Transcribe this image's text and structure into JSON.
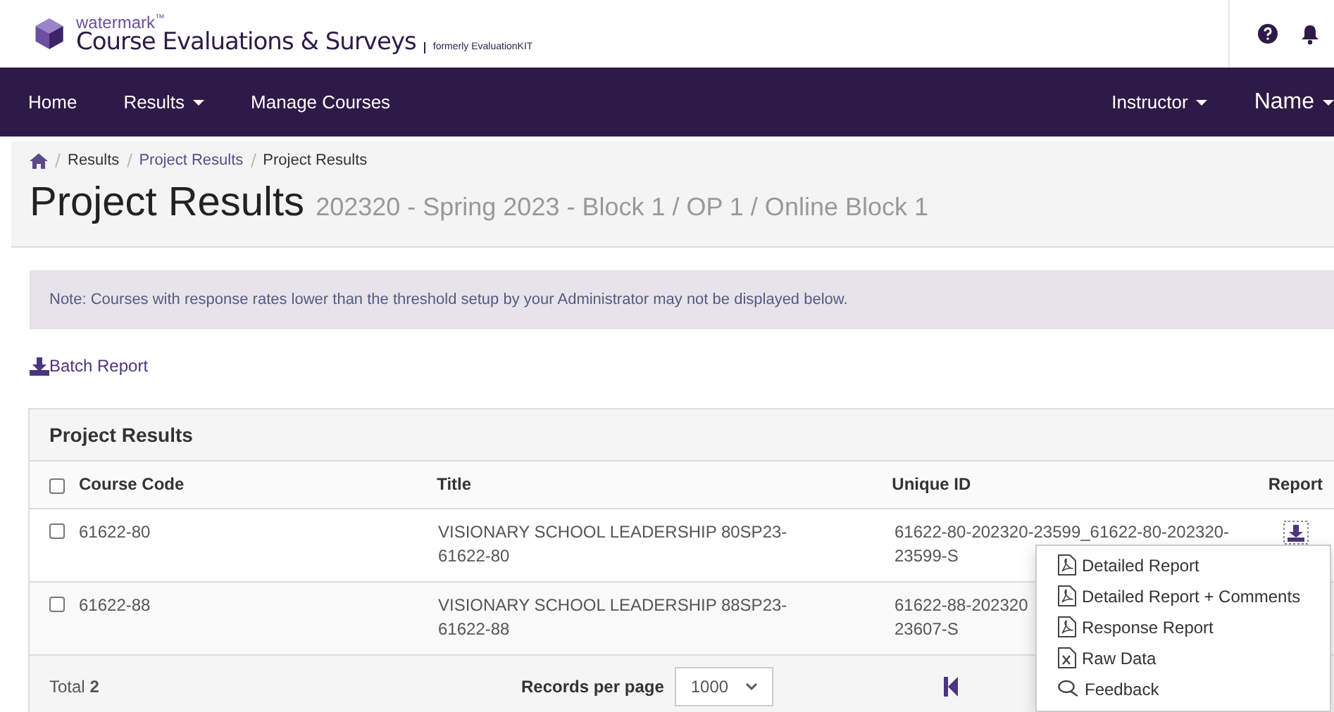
{
  "brand": {
    "name": "watermark",
    "trademark": "™",
    "product": "Course Evaluations & Surveys",
    "former": "formerly EvaluationKIT"
  },
  "nav": {
    "left": [
      {
        "label": "Home",
        "has_menu": false
      },
      {
        "label": "Results",
        "has_menu": true
      },
      {
        "label": "Manage Courses",
        "has_menu": false
      }
    ],
    "right": [
      {
        "label": "Instructor",
        "has_menu": true,
        "large": false
      },
      {
        "label": "Name",
        "has_menu": true,
        "large": true
      }
    ]
  },
  "breadcrumb": [
    "Results",
    "Project Results",
    "Project Results"
  ],
  "page": {
    "title": "Project Results",
    "subtitle": "202320 - Spring 2023 - Block 1 / OP 1 / Online Block 1"
  },
  "note": "Note: Courses with response rates lower than the threshold setup by your Administrator may not be displayed below.",
  "batch_report": "Batch Report",
  "table": {
    "title": "Project Results",
    "select_all_checked": false,
    "columns": [
      "Course Code",
      "Title",
      "Unique ID",
      "Report"
    ],
    "rows": [
      {
        "checked": false,
        "code": "61622-80",
        "title": "VISIONARY SCHOOL LEADERSHIP 80SP23-61622-80",
        "unique_id": [
          "61622-80-202320-23599_61622-80-202320-",
          "23599-S"
        ]
      },
      {
        "checked": false,
        "code": "61622-88",
        "title": "VISIONARY SCHOOL LEADERSHIP 88SP23-61622-88",
        "unique_id": [
          "61622-88-202320",
          "23607-S"
        ]
      }
    ],
    "total_label": "Total",
    "total": "2",
    "per_page_label": "Records per page",
    "per_page": "1000"
  },
  "report_menu": [
    {
      "kind": "pdf",
      "label": "Detailed Report"
    },
    {
      "kind": "pdf",
      "label": "Detailed Report + Comments"
    },
    {
      "kind": "pdf",
      "label": "Response Report"
    },
    {
      "kind": "excel",
      "label": "Raw Data"
    },
    {
      "kind": "feedback",
      "label": "Feedback"
    }
  ]
}
